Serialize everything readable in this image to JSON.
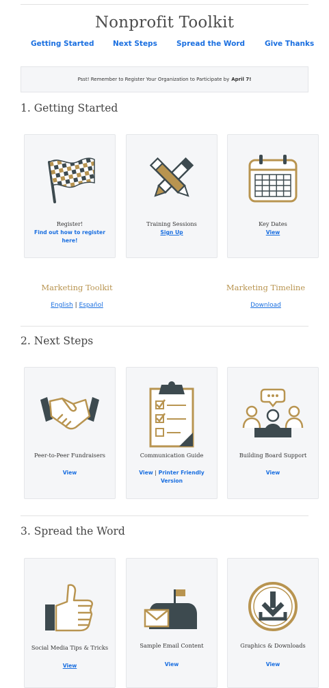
{
  "header": {
    "title": "Nonprofit Toolkit",
    "nav": [
      "Getting Started",
      "Next Steps",
      "Spread the Word",
      "Give Thanks"
    ]
  },
  "notice": {
    "text": "Psst! Remember to Register Your Organization to Participate by",
    "date": "April 7!"
  },
  "sections": [
    {
      "heading": "1. Getting Started",
      "cards": [
        {
          "icon": "checkered-flag-icon",
          "label": "Register!",
          "links": [
            "Find out how to register here!"
          ]
        },
        {
          "icon": "pencil-pen-crossed-icon",
          "label": "Training Sessions",
          "links": [
            "Sign Up"
          ]
        },
        {
          "icon": "calendar-icon",
          "label": "Key Dates",
          "links": [
            "View"
          ]
        }
      ]
    },
    {
      "heading": "2. Next Steps",
      "cards": [
        {
          "icon": "handshake-icon",
          "label": "Peer-to-Peer Fundraisers",
          "links": [
            "View"
          ]
        },
        {
          "icon": "clipboard-checklist-icon",
          "label": "Communication Guide",
          "links": [
            "View",
            "Printer Friendly Version"
          ]
        },
        {
          "icon": "board-meeting-icon",
          "label": "Building Board Support",
          "links": [
            "View"
          ]
        }
      ]
    },
    {
      "heading": "3. Spread the Word",
      "cards": [
        {
          "icon": "thumbs-up-icon",
          "label": "Social Media Tips & Tricks",
          "links": [
            "View"
          ]
        },
        {
          "icon": "mailbox-icon",
          "label": "Sample Email Content",
          "links": [
            "View"
          ]
        },
        {
          "icon": "download-icon",
          "label": "Graphics & Downloads",
          "links": [
            "View"
          ]
        }
      ]
    }
  ],
  "marketing": {
    "toolkit": {
      "title": "Marketing Toolkit",
      "links": [
        "English",
        "Español"
      ],
      "separator": "|"
    },
    "timeline": {
      "title": "Marketing Timeline",
      "links": [
        "Download"
      ]
    }
  },
  "colors": {
    "accent_gold": "#b89450",
    "link_blue": "#1a6fe0",
    "icon_dark": "#3d4a4f",
    "card_bg": "#f5f6f8"
  }
}
